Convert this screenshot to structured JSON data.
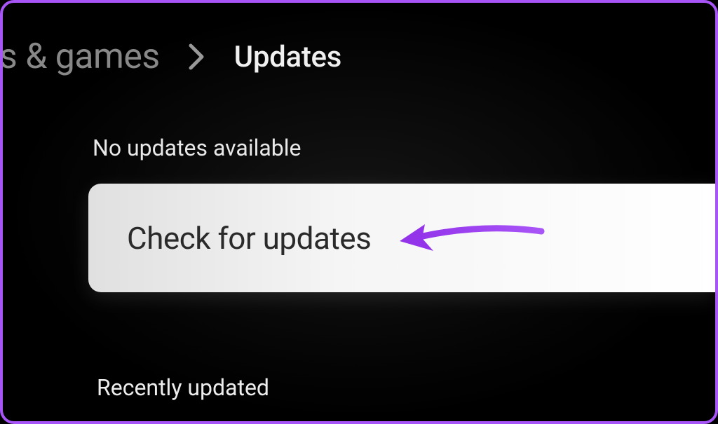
{
  "breadcrumb": {
    "previous": "s & games",
    "current": "Updates"
  },
  "status": {
    "no_updates": "No updates available"
  },
  "actions": {
    "check_updates": "Check for updates"
  },
  "sections": {
    "recently_updated": "Recently updated"
  },
  "colors": {
    "accent": "#a855f7",
    "arrow": "#9333ea"
  }
}
